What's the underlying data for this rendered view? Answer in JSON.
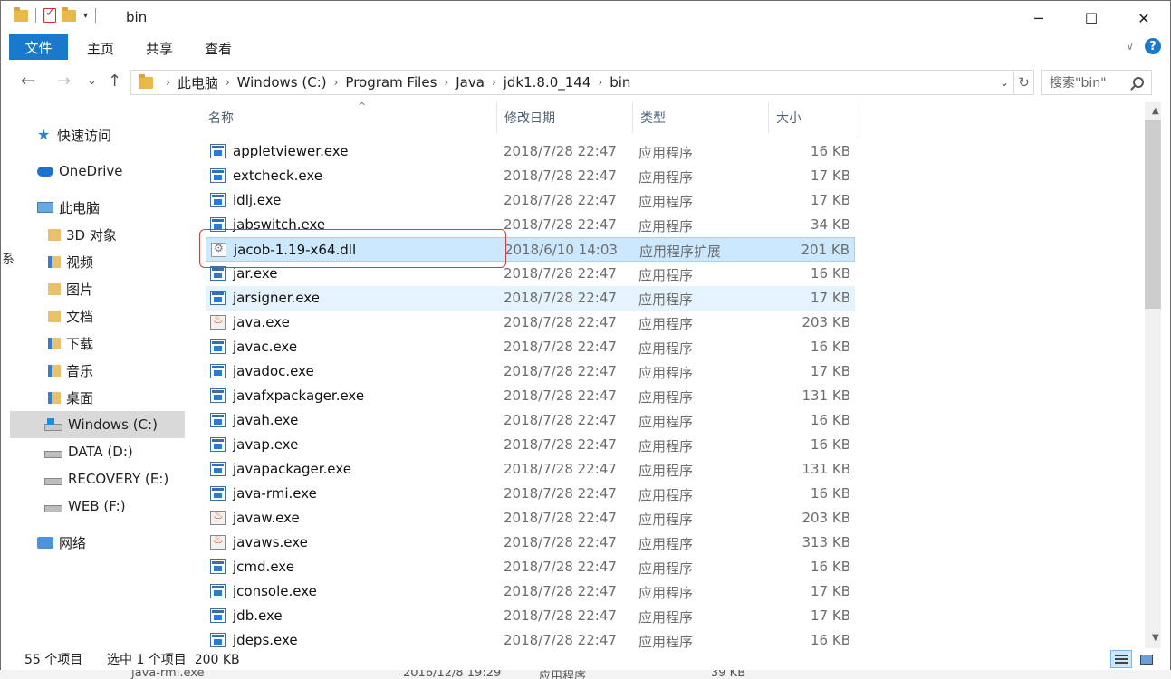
{
  "window": {
    "title": "bin",
    "minimize_glyph": "─",
    "maximize_glyph": "☐",
    "close_glyph": "✕"
  },
  "ribbon": {
    "tabs": [
      {
        "label": "文件",
        "active": true
      },
      {
        "label": "主页"
      },
      {
        "label": "共享"
      },
      {
        "label": "查看"
      }
    ],
    "help_label": "?"
  },
  "nav": {
    "back_glyph": "←",
    "forward_glyph": "→",
    "recent_glyph": "⌄",
    "up_glyph": "↑",
    "breadcrumb": [
      "此电脑",
      "Windows (C:)",
      "Program Files",
      "Java",
      "jdk1.8.0_144",
      "bin"
    ],
    "separator": "›",
    "dropdown_glyph": "⌄",
    "refresh_glyph": "↻",
    "search_placeholder": "搜索\"bin\""
  },
  "sidebar": {
    "edge_char": "系",
    "items": [
      {
        "label": "快速访问",
        "icon": "star-icon",
        "level": 0
      },
      {
        "label": "OneDrive",
        "icon": "cloud-icon",
        "level": 0
      },
      {
        "label": "此电脑",
        "icon": "pc-icon",
        "level": 0
      },
      {
        "label": "3D 对象",
        "icon": "folder-3d-icon",
        "level": 1
      },
      {
        "label": "视频",
        "icon": "folder-video-icon",
        "level": 1
      },
      {
        "label": "图片",
        "icon": "folder-pictures-icon",
        "level": 1
      },
      {
        "label": "文档",
        "icon": "folder-documents-icon",
        "level": 1
      },
      {
        "label": "下载",
        "icon": "folder-downloads-icon",
        "level": 1
      },
      {
        "label": "音乐",
        "icon": "folder-music-icon",
        "level": 1
      },
      {
        "label": "桌面",
        "icon": "folder-desktop-icon",
        "level": 1
      },
      {
        "label": "Windows (C:)",
        "icon": "windows-drive-icon",
        "level": 1,
        "selected": true
      },
      {
        "label": "DATA (D:)",
        "icon": "drive-icon",
        "level": 1
      },
      {
        "label": "RECOVERY (E:)",
        "icon": "drive-icon",
        "level": 1
      },
      {
        "label": "WEB (F:)",
        "icon": "drive-icon",
        "level": 1
      },
      {
        "label": "网络",
        "icon": "network-icon",
        "level": 0
      }
    ]
  },
  "columns": {
    "name": "名称",
    "date": "修改日期",
    "type": "类型",
    "size": "大小",
    "sort_glyph": "^"
  },
  "files": [
    {
      "name": "appletviewer.exe",
      "date": "2018/7/28 22:47",
      "type": "应用程序",
      "size": "16 KB",
      "icon": "exe"
    },
    {
      "name": "extcheck.exe",
      "date": "2018/7/28 22:47",
      "type": "应用程序",
      "size": "17 KB",
      "icon": "exe"
    },
    {
      "name": "idlj.exe",
      "date": "2018/7/28 22:47",
      "type": "应用程序",
      "size": "17 KB",
      "icon": "exe"
    },
    {
      "name": "jabswitch.exe",
      "date": "2018/7/28 22:47",
      "type": "应用程序",
      "size": "34 KB",
      "icon": "exe"
    },
    {
      "name": "jacob-1.19-x64.dll",
      "date": "2018/6/10 14:03",
      "type": "应用程序扩展",
      "size": "201 KB",
      "icon": "dll",
      "selected": true
    },
    {
      "name": "jar.exe",
      "date": "2018/7/28 22:47",
      "type": "应用程序",
      "size": "16 KB",
      "icon": "exe"
    },
    {
      "name": "jarsigner.exe",
      "date": "2018/7/28 22:47",
      "type": "应用程序",
      "size": "17 KB",
      "icon": "exe",
      "hover": true
    },
    {
      "name": "java.exe",
      "date": "2018/7/28 22:47",
      "type": "应用程序",
      "size": "203 KB",
      "icon": "java"
    },
    {
      "name": "javac.exe",
      "date": "2018/7/28 22:47",
      "type": "应用程序",
      "size": "16 KB",
      "icon": "exe"
    },
    {
      "name": "javadoc.exe",
      "date": "2018/7/28 22:47",
      "type": "应用程序",
      "size": "17 KB",
      "icon": "exe"
    },
    {
      "name": "javafxpackager.exe",
      "date": "2018/7/28 22:47",
      "type": "应用程序",
      "size": "131 KB",
      "icon": "exe"
    },
    {
      "name": "javah.exe",
      "date": "2018/7/28 22:47",
      "type": "应用程序",
      "size": "16 KB",
      "icon": "exe"
    },
    {
      "name": "javap.exe",
      "date": "2018/7/28 22:47",
      "type": "应用程序",
      "size": "16 KB",
      "icon": "exe"
    },
    {
      "name": "javapackager.exe",
      "date": "2018/7/28 22:47",
      "type": "应用程序",
      "size": "131 KB",
      "icon": "exe"
    },
    {
      "name": "java-rmi.exe",
      "date": "2018/7/28 22:47",
      "type": "应用程序",
      "size": "16 KB",
      "icon": "exe"
    },
    {
      "name": "javaw.exe",
      "date": "2018/7/28 22:47",
      "type": "应用程序",
      "size": "203 KB",
      "icon": "java"
    },
    {
      "name": "javaws.exe",
      "date": "2018/7/28 22:47",
      "type": "应用程序",
      "size": "313 KB",
      "icon": "java"
    },
    {
      "name": "jcmd.exe",
      "date": "2018/7/28 22:47",
      "type": "应用程序",
      "size": "16 KB",
      "icon": "exe"
    },
    {
      "name": "jconsole.exe",
      "date": "2018/7/28 22:47",
      "type": "应用程序",
      "size": "17 KB",
      "icon": "exe"
    },
    {
      "name": "jdb.exe",
      "date": "2018/7/28 22:47",
      "type": "应用程序",
      "size": "17 KB",
      "icon": "exe"
    },
    {
      "name": "jdeps.exe",
      "date": "2018/7/28 22:47",
      "type": "应用程序",
      "size": "16 KB",
      "icon": "exe"
    }
  ],
  "status": {
    "item_count": "55 个项目",
    "selection": "选中 1 个项目  200 KB"
  },
  "scrollbar": {
    "up_glyph": "▲",
    "down_glyph": "▼"
  },
  "background_window": {
    "name": "java-rmi.exe",
    "date": "2016/12/8 19:29",
    "type": "应用程序",
    "size": "39 KB"
  },
  "colors": {
    "accent": "#1979ca",
    "selected_row": "#cce8ff",
    "highlight_box": "#e0383a"
  }
}
